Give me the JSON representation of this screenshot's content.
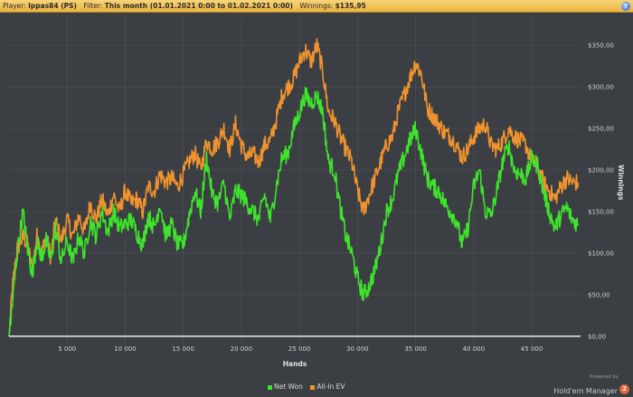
{
  "header": {
    "player_label": "Player:",
    "player_value": "Ippas84 (PS)",
    "filter_label": "Filter:",
    "filter_value": "This month (01.01.2021 0:00 to 01.02.2021 0:00)",
    "winnings_label": "Winnings:",
    "winnings_value": "$135,95",
    "help_icon": "?"
  },
  "brand": {
    "powered_by": "Powered by",
    "name": "Hold'em Manager",
    "version": "2"
  },
  "colors": {
    "net_won": "#3ee42c",
    "all_in_ev": "#f0932e",
    "background": "#3b3e42",
    "grid": "#4c5055",
    "zero_line": "#ffffff"
  },
  "chart_data": {
    "type": "line",
    "xlabel": "Hands",
    "ylabel": "Winnings",
    "xlim": [
      0,
      49200
    ],
    "ylim": [
      -10,
      385
    ],
    "x_ticks": [
      5000,
      10000,
      15000,
      20000,
      25000,
      30000,
      35000,
      40000,
      45000
    ],
    "x_tick_labels": [
      "5 000",
      "10 000",
      "15 000",
      "20 000",
      "25 000",
      "30 000",
      "35 000",
      "40 000",
      "45 000"
    ],
    "y_ticks": [
      0,
      50,
      100,
      150,
      200,
      250,
      300,
      350
    ],
    "y_tick_labels": [
      "$0,00",
      "$50,00",
      "$100,00",
      "$150,00",
      "$200,00",
      "$250,00",
      "$300,00",
      "$350,00"
    ],
    "grid": true,
    "legend_position": "bottom-center",
    "series": [
      {
        "name": "Net Won",
        "color": "#3ee42c",
        "x": [
          0,
          300,
          700,
          1200,
          1600,
          2000,
          2400,
          2800,
          3200,
          3600,
          4000,
          4500,
          5000,
          5500,
          6000,
          6500,
          7000,
          7500,
          8000,
          8500,
          9000,
          9500,
          10000,
          10500,
          11000,
          11500,
          12000,
          12500,
          13000,
          13500,
          14000,
          14500,
          15000,
          15500,
          16000,
          16500,
          17000,
          17500,
          18000,
          18500,
          19000,
          19500,
          20000,
          20500,
          21000,
          21500,
          22000,
          22500,
          23000,
          23500,
          24000,
          24500,
          25000,
          25500,
          26000,
          26500,
          27000,
          27500,
          28000,
          28500,
          29000,
          29500,
          30000,
          30500,
          31000,
          31500,
          32000,
          32500,
          33000,
          33500,
          34000,
          34500,
          35000,
          35500,
          36000,
          36500,
          37000,
          37500,
          38000,
          38500,
          39000,
          39500,
          40000,
          40500,
          41000,
          41500,
          42000,
          42500,
          43000,
          43500,
          44000,
          44500,
          45000,
          45500,
          46000,
          46500,
          47000,
          47500,
          48000,
          48500,
          49000
        ],
        "values": [
          0,
          40,
          100,
          150,
          105,
          75,
          115,
          95,
          115,
          90,
          130,
          90,
          115,
          90,
          120,
          100,
          140,
          120,
          150,
          125,
          150,
          130,
          135,
          140,
          125,
          110,
          145,
          130,
          160,
          120,
          135,
          110,
          110,
          145,
          175,
          150,
          215,
          170,
          160,
          185,
          140,
          175,
          170,
          160,
          150,
          140,
          170,
          140,
          180,
          215,
          220,
          250,
          270,
          290,
          280,
          290,
          270,
          210,
          200,
          155,
          120,
          100,
          70,
          50,
          60,
          80,
          110,
          150,
          165,
          195,
          215,
          235,
          250,
          220,
          190,
          180,
          175,
          160,
          150,
          140,
          110,
          130,
          180,
          200,
          150,
          145,
          175,
          210,
          230,
          200,
          195,
          190,
          215,
          205,
          175,
          150,
          130,
          145,
          155,
          140,
          135
        ]
      },
      {
        "name": "All-In EV",
        "color": "#f0932e",
        "x": [
          0,
          300,
          700,
          1200,
          1600,
          2000,
          2400,
          2800,
          3200,
          3600,
          4000,
          4500,
          5000,
          5500,
          6000,
          6500,
          7000,
          7500,
          8000,
          8500,
          9000,
          9500,
          10000,
          10500,
          11000,
          11500,
          12000,
          12500,
          13000,
          13500,
          14000,
          14500,
          15000,
          15500,
          16000,
          16500,
          17000,
          17500,
          18000,
          18500,
          19000,
          19500,
          20000,
          20500,
          21000,
          21500,
          22000,
          22500,
          23000,
          23500,
          24000,
          24500,
          25000,
          25500,
          26000,
          26500,
          27000,
          27500,
          28000,
          28500,
          29000,
          29500,
          30000,
          30500,
          31000,
          31500,
          32000,
          32500,
          33000,
          33500,
          34000,
          34500,
          35000,
          35500,
          36000,
          36500,
          37000,
          37500,
          38000,
          38500,
          39000,
          39500,
          40000,
          40500,
          41000,
          41500,
          42000,
          42500,
          43000,
          43500,
          44000,
          44500,
          45000,
          45500,
          46000,
          46500,
          47000,
          47500,
          48000,
          48500,
          49000
        ],
        "values": [
          0,
          60,
          105,
          120,
          110,
          80,
          120,
          100,
          120,
          95,
          140,
          115,
          140,
          120,
          145,
          125,
          160,
          140,
          165,
          145,
          170,
          150,
          175,
          160,
          165,
          150,
          180,
          175,
          195,
          185,
          190,
          180,
          195,
          210,
          220,
          200,
          235,
          225,
          235,
          250,
          225,
          255,
          230,
          215,
          220,
          210,
          230,
          235,
          260,
          290,
          300,
          310,
          330,
          345,
          330,
          350,
          320,
          270,
          260,
          240,
          225,
          210,
          175,
          150,
          170,
          190,
          210,
          230,
          240,
          270,
          290,
          310,
          330,
          315,
          275,
          265,
          255,
          245,
          240,
          230,
          215,
          225,
          240,
          250,
          255,
          230,
          225,
          235,
          250,
          240,
          235,
          230,
          210,
          205,
          185,
          175,
          165,
          180,
          190,
          185,
          185
        ]
      }
    ]
  }
}
